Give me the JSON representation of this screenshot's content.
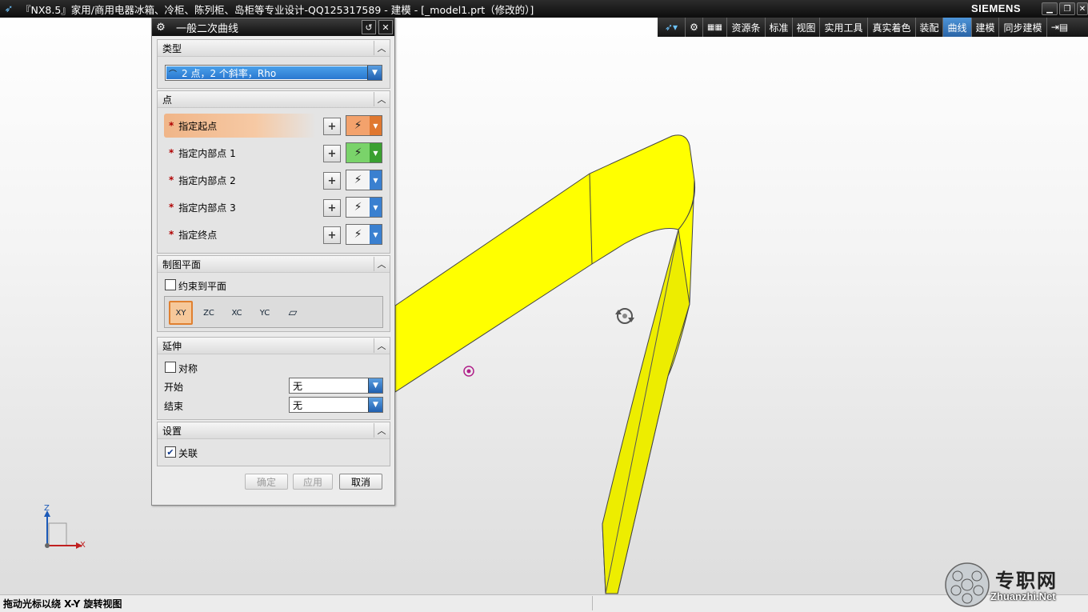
{
  "window": {
    "title": "『NX8.5』家用/商用电器冰箱、冷柜、陈列柜、岛柜等专业设计-QQ125317589 - 建模 - [_model1.prt（修改的）]",
    "brand": "SIEMENS"
  },
  "toolbar": {
    "items": [
      "资源条",
      "标准",
      "视图",
      "实用工具",
      "真实着色",
      "装配",
      "曲线",
      "建模",
      "同步建模"
    ],
    "active": "曲线"
  },
  "dialog": {
    "title": "一般二次曲线",
    "type_group": {
      "header": "类型",
      "selected": "2 点，2 个斜率，Rho"
    },
    "points_group": {
      "header": "点",
      "items": [
        "指定起点",
        "指定内部点 1",
        "指定内部点 2",
        "指定内部点 3",
        "指定终点"
      ]
    },
    "plane_group": {
      "header": "制图平面",
      "constrain_label": "约束到平面",
      "icons": [
        "XY",
        "ZC",
        "XC",
        "YC",
        ""
      ]
    },
    "extend_group": {
      "header": "延伸",
      "symmetric_label": "对称",
      "start_label": "开始",
      "start_value": "无",
      "end_label": "结束",
      "end_value": "无"
    },
    "settings_group": {
      "header": "设置",
      "associative_label": "关联"
    },
    "buttons": {
      "ok": "确定",
      "apply": "应用",
      "cancel": "取消"
    }
  },
  "triad": {
    "z": "Z",
    "x": "X"
  },
  "status_bar": {
    "message": "拖动光标以绕 X-Y 旋转视图"
  },
  "watermark": {
    "text": "专职网",
    "url": "Zhuanzhi.Net"
  },
  "colors": {
    "surface": "#ffff00",
    "surface_side": "#e6e600",
    "selected_row": "#f0b588",
    "accent": "#2a64a6"
  }
}
